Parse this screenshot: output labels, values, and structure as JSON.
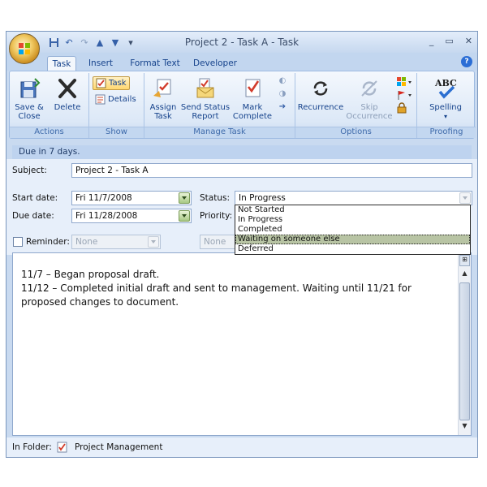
{
  "window": {
    "title": "Project 2 - Task A - Task",
    "controls": {
      "minimize": "_",
      "maximize": "▭",
      "close": "✕"
    }
  },
  "tabs": [
    {
      "label": "Task",
      "active": true
    },
    {
      "label": "Insert"
    },
    {
      "label": "Format Text"
    },
    {
      "label": "Developer"
    }
  ],
  "ribbon": {
    "actions": {
      "label": "Actions",
      "save_close": [
        "Save &",
        "Close"
      ],
      "delete": "Delete"
    },
    "show": {
      "label": "Show",
      "task": "Task",
      "details": "Details"
    },
    "manage_task": {
      "label": "Manage Task",
      "assign": [
        "Assign",
        "Task"
      ],
      "send_status": [
        "Send Status",
        "Report"
      ],
      "mark_complete": [
        "Mark",
        "Complete"
      ]
    },
    "options": {
      "label": "Options",
      "recurrence": "Recurrence",
      "skip": [
        "Skip",
        "Occurrence"
      ]
    },
    "proofing": {
      "label": "Proofing",
      "spelling": "Spelling",
      "abc": "ABC"
    }
  },
  "infobar": "Due in 7 days.",
  "form": {
    "subject_label": "Subject:",
    "subject_value": "Project 2 - Task A",
    "start_label": "Start date:",
    "start_value": "Fri 11/7/2008",
    "due_label": "Due date:",
    "due_value": "Fri 11/28/2008",
    "status_label": "Status:",
    "status_value": "In Progress",
    "priority_label": "Priority:",
    "reminder_label": "Reminder:",
    "reminder_date": "None",
    "reminder_time": "None"
  },
  "status_options": [
    "Not Started",
    "In Progress",
    "Completed",
    "Waiting on someone else",
    "Deferred"
  ],
  "status_highlighted": "Waiting on someone else",
  "notes": [
    "11/7 – Began proposal draft.",
    "11/12 – Completed initial draft and sent to management. Waiting until 11/21 for proposed changes to document."
  ],
  "folder": {
    "label": "In Folder:",
    "value": "Project Management"
  },
  "colors": {
    "accent": "#15428b",
    "ribbon_bg": "#dce8f7",
    "highlight": "#b8c4a4"
  }
}
